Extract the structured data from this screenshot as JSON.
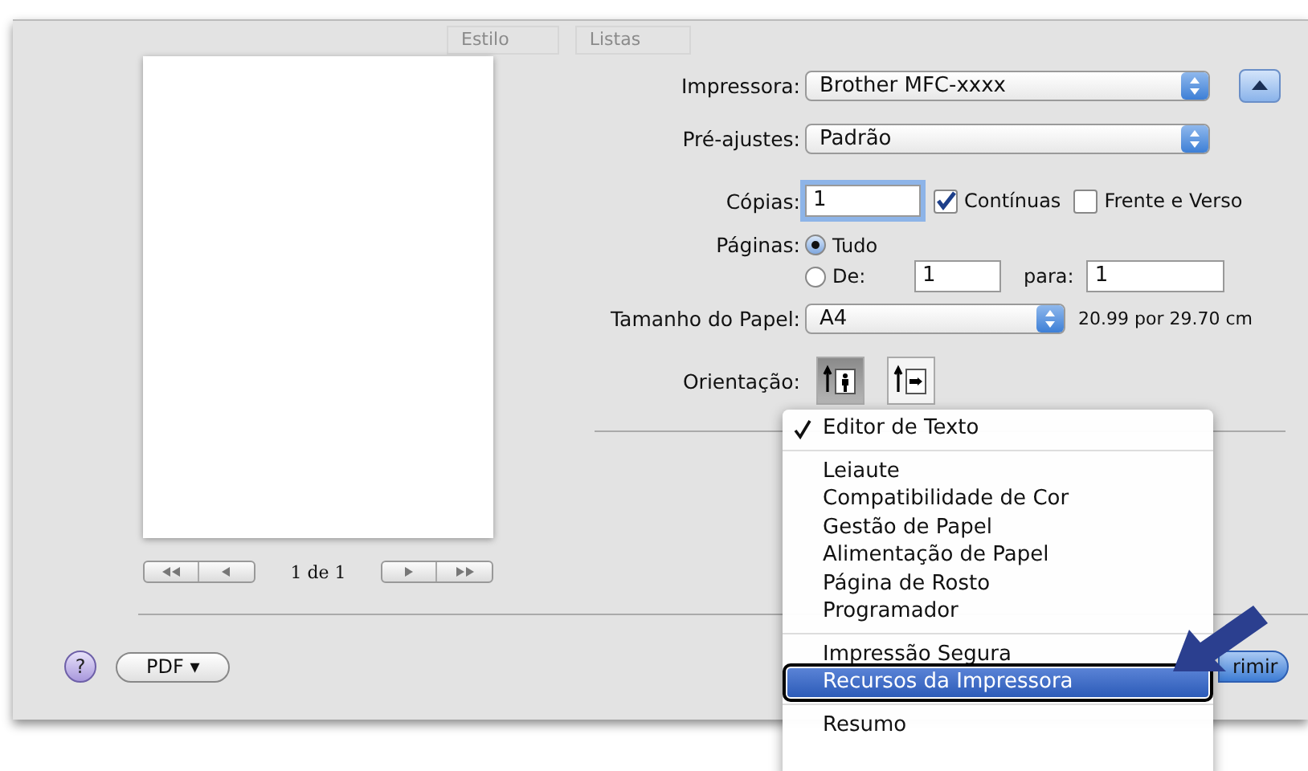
{
  "background_toolbar": {
    "items": [
      "Estilo",
      "Listas"
    ]
  },
  "preview": {
    "page_counter": "1 de 1"
  },
  "form": {
    "printer": {
      "label": "Impressora:",
      "value": "Brother MFC-xxxx"
    },
    "presets": {
      "label": "Pré-ajustes:",
      "value": "Padrão"
    },
    "copies": {
      "label": "Cópias:",
      "value": "1"
    },
    "collated": {
      "label": "Contínuas",
      "checked": true
    },
    "two_sided": {
      "label": "Frente e Verso",
      "checked": false
    },
    "pages": {
      "label": "Páginas:",
      "options": [
        {
          "label": "Tudo",
          "selected": true
        },
        {
          "label": "De:",
          "selected": false
        }
      ],
      "from": "1",
      "to_label": "para:",
      "to": "1"
    },
    "paper_size": {
      "label": "Tamanho do Papel:",
      "value": "A4",
      "dimensions": "20.99 por 29.70 cm"
    },
    "orientation": {
      "label": "Orientação:",
      "options": [
        {
          "kind": "portrait",
          "selected": true
        },
        {
          "kind": "landscape",
          "selected": false
        }
      ]
    }
  },
  "footer": {
    "help": "?",
    "pdf_button": "PDF ▾",
    "print_button": "rimir"
  },
  "menu": {
    "items": [
      {
        "kind": "item",
        "label": "Editor de Texto",
        "checked": true,
        "selected": false
      },
      {
        "kind": "separator"
      },
      {
        "kind": "item",
        "label": "Leiaute",
        "checked": false,
        "selected": false
      },
      {
        "kind": "item",
        "label": "Compatibilidade de Cor",
        "checked": false,
        "selected": false
      },
      {
        "kind": "item",
        "label": "Gestão de Papel",
        "checked": false,
        "selected": false
      },
      {
        "kind": "item",
        "label": "Alimentação de Papel",
        "checked": false,
        "selected": false
      },
      {
        "kind": "item",
        "label": "Página de Rosto",
        "checked": false,
        "selected": false
      },
      {
        "kind": "item",
        "label": "Programador",
        "checked": false,
        "selected": false
      },
      {
        "kind": "separator"
      },
      {
        "kind": "item",
        "label": "Impressão Segura",
        "checked": false,
        "selected": false
      },
      {
        "kind": "item",
        "label": "Recursos da Impressora",
        "checked": false,
        "selected": true
      },
      {
        "kind": "separator"
      },
      {
        "kind": "item",
        "label": "Resumo",
        "checked": false,
        "selected": false
      }
    ]
  }
}
